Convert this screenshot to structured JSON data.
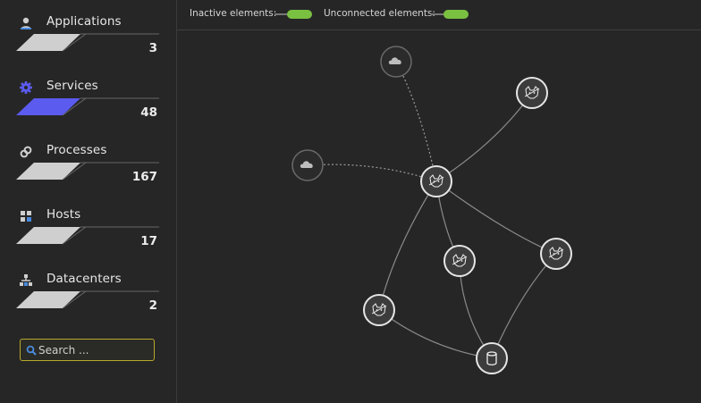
{
  "sidebar": {
    "categories": [
      {
        "label": "Applications",
        "count": "3",
        "icon": "user-icon",
        "bar_color": "#cfcfcf"
      },
      {
        "label": "Services",
        "count": "48",
        "icon": "gear-icon",
        "bar_color": "#5b5bef"
      },
      {
        "label": "Processes",
        "count": "167",
        "icon": "link-icon",
        "bar_color": "#cfcfcf"
      },
      {
        "label": "Hosts",
        "count": "17",
        "icon": "grid-icon",
        "bar_color": "#cfcfcf"
      },
      {
        "label": "Datacenters",
        "count": "2",
        "icon": "hierarchy-icon",
        "bar_color": "#cfcfcf"
      }
    ],
    "search": {
      "placeholder": "Search ...",
      "value": ""
    }
  },
  "toolbar": {
    "inactive_label": "Inactive elements:",
    "inactive_on": true,
    "unconnected_label": "Unconnected elements:",
    "unconnected_on": true,
    "toggle_color": "#7ac142"
  },
  "graph": {
    "nodes": [
      {
        "id": "cloud-top",
        "icon": "cloud-icon",
        "inactive": true
      },
      {
        "id": "cloud-left",
        "icon": "cloud-icon",
        "inactive": true
      },
      {
        "id": "svc-hub",
        "icon": "tomcat-icon"
      },
      {
        "id": "svc-top-right",
        "icon": "tomcat-icon"
      },
      {
        "id": "svc-middle",
        "icon": "tomcat-icon"
      },
      {
        "id": "svc-right",
        "icon": "tomcat-icon"
      },
      {
        "id": "svc-left",
        "icon": "tomcat-icon"
      },
      {
        "id": "db",
        "icon": "database-icon"
      }
    ],
    "edges": [
      {
        "from": "cloud-top",
        "to": "svc-hub",
        "style": "dotted"
      },
      {
        "from": "cloud-left",
        "to": "svc-hub",
        "style": "dotted"
      },
      {
        "from": "svc-hub",
        "to": "svc-top-right",
        "style": "solid"
      },
      {
        "from": "svc-hub",
        "to": "svc-middle",
        "style": "solid"
      },
      {
        "from": "svc-hub",
        "to": "svc-right",
        "style": "solid"
      },
      {
        "from": "svc-hub",
        "to": "svc-left",
        "style": "solid"
      },
      {
        "from": "svc-middle",
        "to": "db",
        "style": "solid"
      },
      {
        "from": "svc-right",
        "to": "db",
        "style": "solid"
      },
      {
        "from": "svc-left",
        "to": "db",
        "style": "solid"
      }
    ]
  }
}
